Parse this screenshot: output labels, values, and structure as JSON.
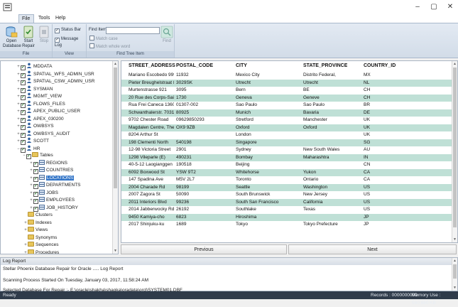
{
  "window": {
    "controls": {
      "minimize": "–",
      "maximize": "▢",
      "close": "✕"
    }
  },
  "menu": {
    "tabs": [
      {
        "label": "File",
        "active": true
      },
      {
        "label": "Tools"
      },
      {
        "label": "Help"
      }
    ]
  },
  "ribbon": {
    "file_group": {
      "title": "File",
      "open_label_1": "Open",
      "open_label_2": "Database",
      "start_label_1": "Start",
      "start_label_2": "Repair",
      "stop_label": "Stop"
    },
    "view_group": {
      "title": "View",
      "status_bar": {
        "label": "Status Bar",
        "checked": true
      },
      "message_log": {
        "label": "Message Log",
        "checked": true
      }
    },
    "find_group": {
      "title": "Find Tree Item",
      "find_item_label": "Find Item",
      "find_item_value": "",
      "match_case": "Match case",
      "match_whole_word": "Match whole word",
      "find_button": "Find"
    }
  },
  "tree": {
    "nodes": [
      {
        "label": "MDDATA",
        "kind": "user",
        "expander": "+"
      },
      {
        "label": "SPATIAL_WFS_ADMIN_USR",
        "kind": "user",
        "expander": "+"
      },
      {
        "label": "SPATIAL_CSW_ADMIN_USR",
        "kind": "user",
        "expander": "+"
      },
      {
        "label": "SYSMAN",
        "kind": "user",
        "expander": "+"
      },
      {
        "label": "MGMT_VIEW",
        "kind": "user",
        "expander": "+"
      },
      {
        "label": "FLOWS_FILES",
        "kind": "user",
        "expander": "+"
      },
      {
        "label": "APEX_PUBLIC_USER",
        "kind": "user",
        "expander": "+"
      },
      {
        "label": "APEX_030200",
        "kind": "user",
        "expander": "+"
      },
      {
        "label": "OWBSYS",
        "kind": "user",
        "expander": "+"
      },
      {
        "label": "OWBSYS_AUDIT",
        "kind": "user",
        "expander": "+"
      },
      {
        "label": "SCOTT",
        "kind": "user",
        "expander": "+"
      },
      {
        "label": "HR",
        "kind": "user",
        "expander": "−"
      },
      {
        "label": "Tables",
        "kind": "folder",
        "expander": "−"
      },
      {
        "label": "REGIONS",
        "kind": "table",
        "expander": "+"
      },
      {
        "label": "COUNTRIES",
        "kind": "table",
        "expander": "+"
      },
      {
        "label": "LOCATIONS",
        "kind": "table",
        "expander": "+",
        "selected": true
      },
      {
        "label": "DEPARTMENTS",
        "kind": "table",
        "expander": "+"
      },
      {
        "label": "JOBS",
        "kind": "table",
        "expander": "+"
      },
      {
        "label": "EMPLOYEES",
        "kind": "table",
        "expander": "+"
      },
      {
        "label": "JOB_HISTORY",
        "kind": "table",
        "expander": "+"
      },
      {
        "label": "Clusters",
        "kind": "folder"
      },
      {
        "label": "Indexes",
        "kind": "folder",
        "expander": "+"
      },
      {
        "label": "Views",
        "kind": "folder",
        "expander": "+"
      },
      {
        "label": "Synonyms",
        "kind": "folder"
      },
      {
        "label": "Sequences",
        "kind": "folder",
        "expander": "+"
      },
      {
        "label": "Procedures",
        "kind": "folder",
        "expander": "+"
      }
    ]
  },
  "grid": {
    "columns": [
      "STREET_ADDRESS",
      "POSTAL_CODE",
      "CITY",
      "STATE_PROVINCE",
      "COUNTRY_ID"
    ],
    "rows": [
      [
        "Mariano Escobedo 9991",
        "11932",
        "Mexico City",
        "Distrito Federal,",
        "MX"
      ],
      [
        "Pieter Breughelstraat 837",
        "3029SK",
        "Utrecht",
        "Utrecht",
        "NL"
      ],
      [
        "Murtenstrasse 921",
        "3095",
        "Bern",
        "BE",
        "CH"
      ],
      [
        "20 Rue des Corps-Saints",
        "1730",
        "Geneva",
        "Geneve",
        "CH"
      ],
      [
        "Rua Frei Caneca 1360",
        "01307-002",
        "Sao Paulo",
        "Sao Paulo",
        "BR"
      ],
      [
        "Schwanthalerstr. 7031",
        "80925",
        "Munich",
        "Bavaria",
        "DE"
      ],
      [
        "9702 Chester Road",
        "09629850293",
        "Stretford",
        "Manchester",
        "UK"
      ],
      [
        "Magdalen Centre, The ...",
        "OX9 9ZB",
        "Oxford",
        "Oxford",
        "UK"
      ],
      [
        "8204 Arthur St",
        "",
        "London",
        "",
        "UK"
      ],
      [
        "198 Clementi North",
        "540198",
        "Singapore",
        "",
        "SG"
      ],
      [
        "12-98 Victoria Street",
        "2901",
        "Sydney",
        "New South Wales",
        "AU"
      ],
      [
        "1298 Vileparle (E)",
        "490231",
        "Bombay",
        "Maharashtra",
        "IN"
      ],
      [
        "40-5-12 Laogianggen",
        "190518",
        "Beijing",
        "",
        "CN"
      ],
      [
        "6092 Boxwood St",
        "YSW 9T2",
        "Whitehorse",
        "Yukon",
        "CA"
      ],
      [
        "147 Spadina Ave",
        "M5V 2L7",
        "Toronto",
        "Ontario",
        "CA"
      ],
      [
        "2004 Charade Rd",
        "98199",
        "Seattle",
        "Washington",
        "US"
      ],
      [
        "2007 Zagora St",
        "50090",
        "South Brunswick",
        "New Jersey",
        "US"
      ],
      [
        "2011 Interiors Blvd",
        "99236",
        "South San Francisco",
        "California",
        "US"
      ],
      [
        "2014 Jabberwocky Rd",
        "26192",
        "Southlake",
        "Texas",
        "US"
      ],
      [
        "9450 Kamiya-cho",
        "6823",
        "Hiroshima",
        "",
        "JP"
      ],
      [
        "2017 Shinjuku-ku",
        "1689",
        "Tokyo",
        "Tokyo Prefecture",
        "JP"
      ]
    ]
  },
  "nav": {
    "previous": "Previous",
    "next": "Next"
  },
  "log": {
    "title": "Log Report",
    "lines": [
      "Stellar Phoenix Database Repair for Oracle ..... Log Report",
      "Scanning Process Started On Tuesday, January 03, 2017, 11:58:24 AM",
      "Selected Database For Repair :- E:\\oracle\\shakha\\shagka\\oradata\\orcl\\SYSTEM01.DBF"
    ]
  },
  "status": {
    "ready": "Ready",
    "records": "Records : 0000000000",
    "memory": "Memory Use : 560,660 KB"
  }
}
